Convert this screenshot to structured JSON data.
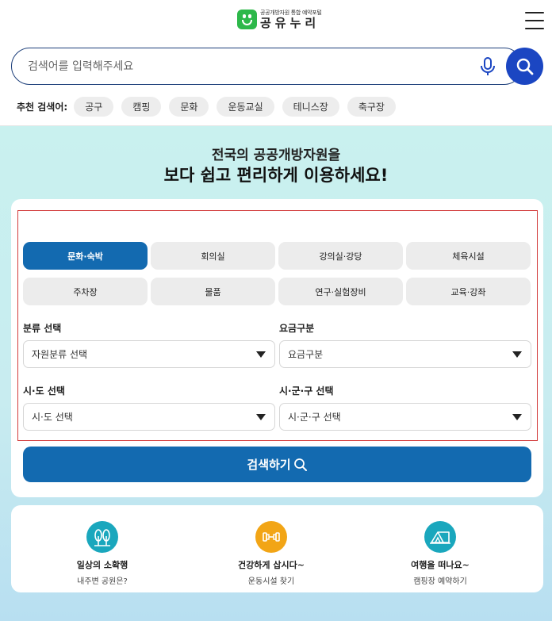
{
  "header": {
    "logo_sub": "공공개방자원 통합 예약포털",
    "logo_main": "공유누리",
    "menu_icon": "hamburger-menu-icon"
  },
  "search": {
    "placeholder": "검색어를 입력해주세요",
    "value": "",
    "mic_icon": "microphone-icon",
    "search_icon": "search-icon"
  },
  "recommended": {
    "label": "추천 검색어:",
    "keywords": [
      "공구",
      "캠핑",
      "문화",
      "운동교실",
      "테니스장",
      "축구장"
    ]
  },
  "hero": {
    "line1": "전국의 공공개방자원을",
    "line2": "보다 쉽고 편리하게 이용하세요!"
  },
  "categories": [
    {
      "label": "문화·숙박",
      "active": true
    },
    {
      "label": "회의실",
      "active": false
    },
    {
      "label": "강의실·강당",
      "active": false
    },
    {
      "label": "체육시설",
      "active": false
    },
    {
      "label": "주차장",
      "active": false
    },
    {
      "label": "물품",
      "active": false
    },
    {
      "label": "연구·실험장비",
      "active": false
    },
    {
      "label": "교육·강좌",
      "active": false
    }
  ],
  "filters": {
    "category_label": "분류 선택",
    "category_value": "자원분류 선택",
    "fee_label": "요금구분",
    "fee_value": "요금구분",
    "sido_label": "시·도 선택",
    "sido_value": "시·도 선택",
    "sigungu_label": "시·군·구 선택",
    "sigungu_value": "시·군·구 선택"
  },
  "submit_label": "검색하기",
  "features": [
    {
      "title": "일상의 소확행",
      "sub": "내주변 공원은?",
      "icon": "trees-icon",
      "color": "#1aa7bd"
    },
    {
      "title": "건강하게 삽시다~",
      "sub": "운동시설 찾기",
      "icon": "dumbbell-icon",
      "color": "#f2a516"
    },
    {
      "title": "여행을 떠나요~",
      "sub": "캠핑장 예약하기",
      "icon": "tent-icon",
      "color": "#1aa7bd"
    }
  ],
  "colors": {
    "primary": "#136ab0",
    "search_button": "#1b46c2",
    "logo_green": "#2db84a",
    "hero_bg": "#c9f1ef",
    "highlight_border": "#d23b3b"
  }
}
